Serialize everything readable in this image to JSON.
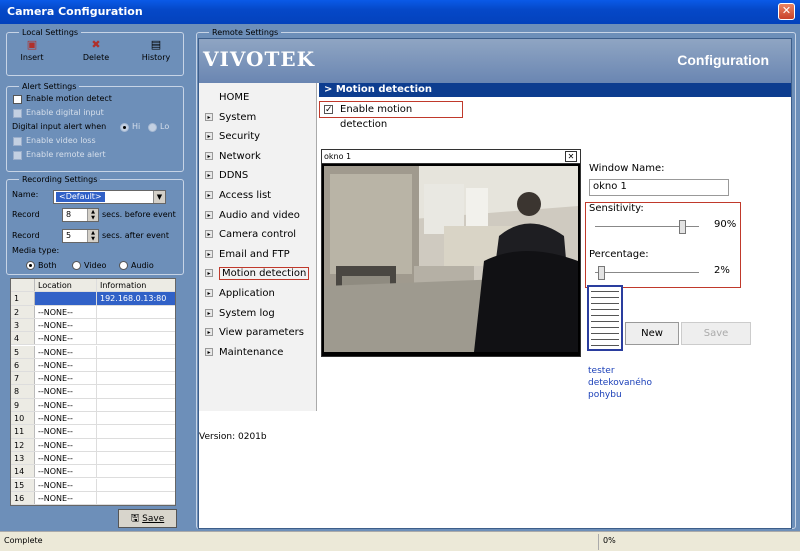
{
  "window": {
    "title": "Camera Configuration",
    "close": "✕"
  },
  "local": {
    "title": "Local Settings",
    "insert": "Insert",
    "delete": "Delete",
    "history": "History"
  },
  "alert": {
    "title": "Alert Settings",
    "enable_motion": "Enable motion detect",
    "enable_digital": "Enable digital input",
    "digital_when": "Digital input alert when",
    "hi": "Hi",
    "lo": "Lo",
    "enable_video_loss": "Enable video loss",
    "enable_remote": "Enable remote alert"
  },
  "recording": {
    "title": "Recording Settings",
    "name_label": "Name:",
    "name_value": "<Default>",
    "record1": "Record",
    "record1_value": "8",
    "record1_suffix": "secs. before event",
    "record2": "Record",
    "record2_value": "5",
    "record2_suffix": "secs. after event",
    "media_type": "Media type:",
    "both": "Both",
    "video": "Video",
    "audio": "Audio"
  },
  "table": {
    "col_location": "Location",
    "col_information": "Information",
    "rows": [
      {
        "n": "1",
        "loc": "",
        "info": "192.168.0.13:80"
      },
      {
        "n": "2",
        "loc": "--NONE--",
        "info": ""
      },
      {
        "n": "3",
        "loc": "--NONE--",
        "info": ""
      },
      {
        "n": "4",
        "loc": "--NONE--",
        "info": ""
      },
      {
        "n": "5",
        "loc": "--NONE--",
        "info": ""
      },
      {
        "n": "6",
        "loc": "--NONE--",
        "info": ""
      },
      {
        "n": "7",
        "loc": "--NONE--",
        "info": ""
      },
      {
        "n": "8",
        "loc": "--NONE--",
        "info": ""
      },
      {
        "n": "9",
        "loc": "--NONE--",
        "info": ""
      },
      {
        "n": "10",
        "loc": "--NONE--",
        "info": ""
      },
      {
        "n": "11",
        "loc": "--NONE--",
        "info": ""
      },
      {
        "n": "12",
        "loc": "--NONE--",
        "info": ""
      },
      {
        "n": "13",
        "loc": "--NONE--",
        "info": ""
      },
      {
        "n": "14",
        "loc": "--NONE--",
        "info": ""
      },
      {
        "n": "15",
        "loc": "--NONE--",
        "info": ""
      },
      {
        "n": "16",
        "loc": "--NONE--",
        "info": ""
      }
    ],
    "save": "Save"
  },
  "remote": {
    "title": "Remote Settings",
    "logo": "VIVOTEK",
    "config_title": "Configuration",
    "nav": [
      {
        "label": "HOME",
        "arrow": false
      },
      {
        "label": "System",
        "arrow": true
      },
      {
        "label": "Security",
        "arrow": true
      },
      {
        "label": "Network",
        "arrow": true
      },
      {
        "label": "DDNS",
        "arrow": true
      },
      {
        "label": "Access list",
        "arrow": true
      },
      {
        "label": "Audio and video",
        "arrow": true
      },
      {
        "label": "Camera control",
        "arrow": true
      },
      {
        "label": "Email and FTP",
        "arrow": true
      },
      {
        "label": "Motion detection",
        "arrow": true,
        "active": true
      },
      {
        "label": "Application",
        "arrow": true
      },
      {
        "label": "System log",
        "arrow": true
      },
      {
        "label": "View parameters",
        "arrow": true
      },
      {
        "label": "Maintenance",
        "arrow": true
      }
    ],
    "version": "Version: 0201b",
    "section": "> Motion detection",
    "enable_md": "Enable motion detection",
    "cam_window_title": "okno 1",
    "window_name_label": "Window Name:",
    "window_name_value": "okno 1",
    "sensitivity_label": "Sensitivity:",
    "sensitivity_value": "90%",
    "sensitivity_level": 0.9,
    "percentage_label": "Percentage:",
    "percentage_value": "2%",
    "percentage_level": 0.02,
    "new": "New",
    "save": "Save",
    "tester1": "tester",
    "tester2": "detekovaného",
    "tester3": "pohybu"
  },
  "status": {
    "left": "Complete",
    "right": "0%"
  },
  "colors": {
    "titlebar": "#0548c8",
    "panel": "#6d8fb9",
    "highlight": "#c0392b",
    "section_bar": "#0d3d8f"
  }
}
